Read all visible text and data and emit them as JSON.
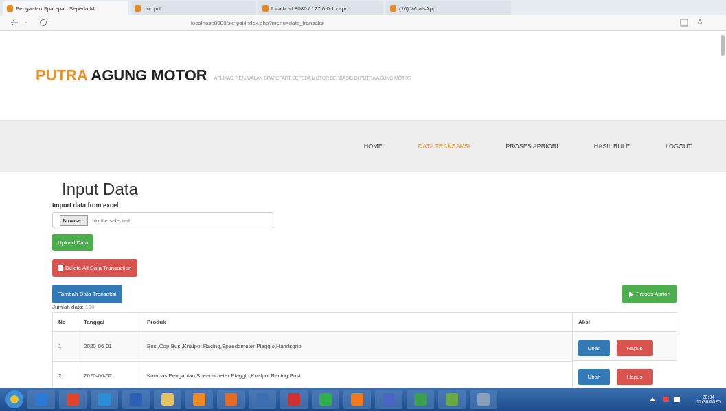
{
  "browser": {
    "tabs": [
      {
        "label": "Pengaalan Sparepart Sepeda M...",
        "selected": true
      },
      {
        "label": "doc.pdf",
        "selected": false
      },
      {
        "label": "localhost:8080 / 127.0.0.1 / apr...",
        "selected": false
      },
      {
        "label": "(10) WhatsApp",
        "selected": false
      }
    ],
    "address": "localhost:8080/skripsi/index.php?menu=data_transaksi"
  },
  "header": {
    "brand_first": "PUTRA",
    "brand_rest": "AGUNG MOTOR",
    "subtitle": "APLIKASI PENJUALAN SPAREPART SEPEDA MOTOR BERBASIS DI PUTRA AGUNG MOTOR"
  },
  "nav": [
    {
      "label": "HOME",
      "selected": false
    },
    {
      "label": "DATA TRANSAKSI",
      "selected": true
    },
    {
      "label": "PROSES APRIORI",
      "selected": false
    },
    {
      "label": "HASIL RULE",
      "selected": false
    },
    {
      "label": "LOGOUT",
      "selected": false
    }
  ],
  "page_title": "Input Data",
  "import_label": "Import data from excel",
  "file_input": {
    "button": "Browse...",
    "value": "No file selected."
  },
  "upload_button": "Upload Data",
  "delete_all_button": "Delete All Data Transaction",
  "add_button": "Tambah Data Transaksi",
  "process_button": "Proses Apriori",
  "count_label": "Jumlah data:",
  "count_value": "100",
  "table": {
    "columns": [
      "No",
      "Tanggal",
      "Produk",
      "Aksi"
    ],
    "rows": [
      {
        "no": "1",
        "date": "2020-06-01",
        "products": "Busi,Cop Busi,Knalpot Racing,Speedometer Piaggio,Handsgrip",
        "edit": "Ubah",
        "delete": "Hapus"
      },
      {
        "no": "2",
        "date": "2020-06-02",
        "products": "Kampas Pengapian,Speedometer Piaggio,Knalpot Racing,Busi",
        "edit": "Ubah",
        "delete": "Hapus"
      }
    ]
  },
  "taskbar": {
    "time": "20:34",
    "date": "12/30/2020"
  }
}
